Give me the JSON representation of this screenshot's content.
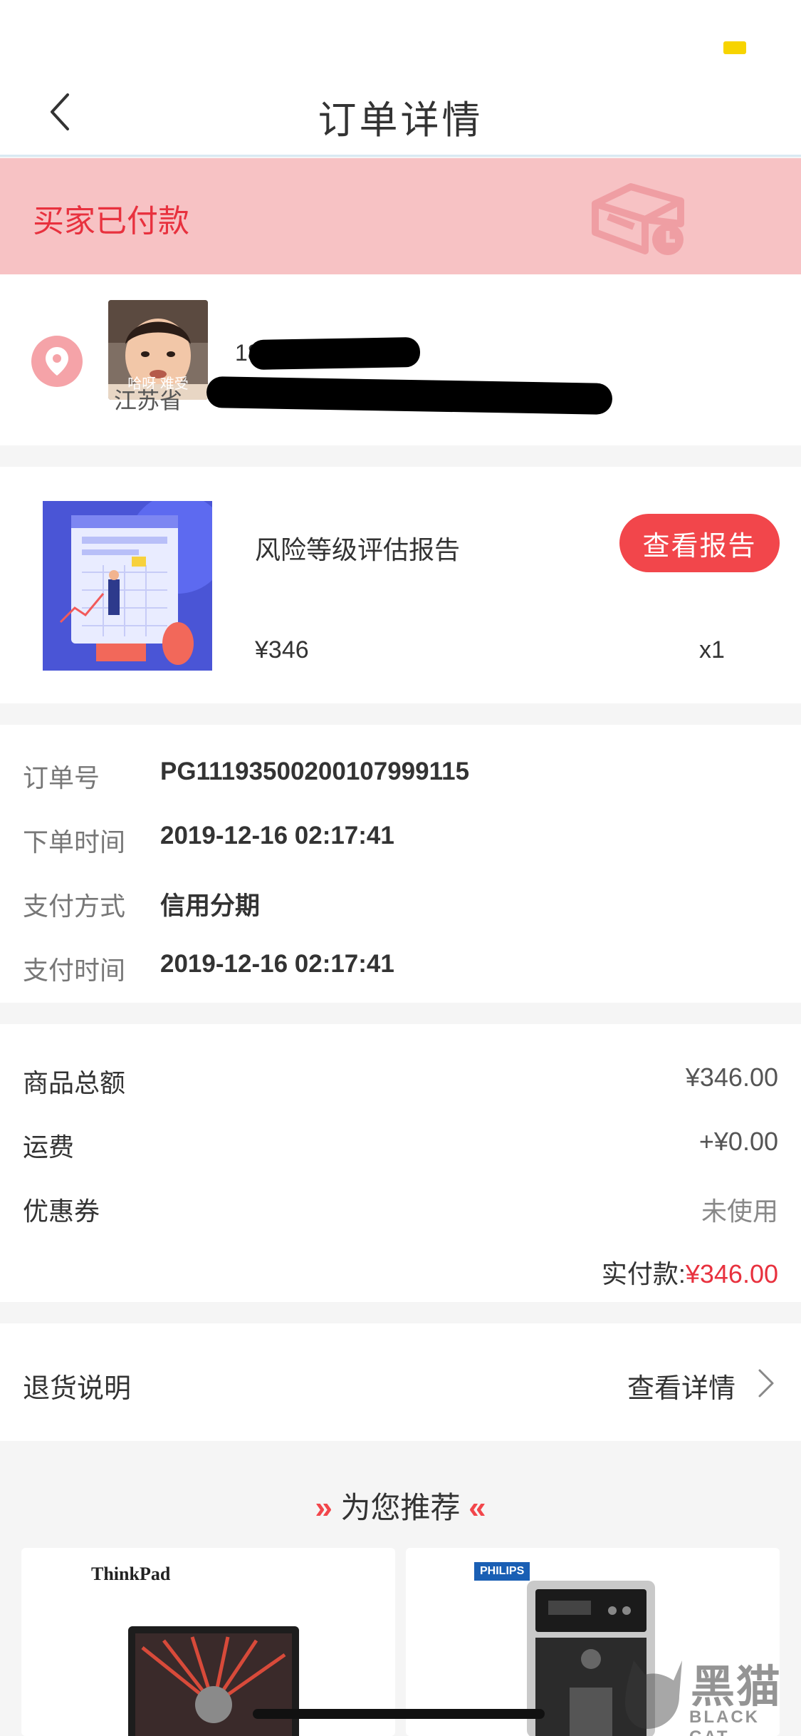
{
  "nav": {
    "title": "订单详情"
  },
  "status": {
    "text": "买家已付款"
  },
  "address": {
    "name": "18",
    "detail": "江苏省",
    "avatar_caption": "哈呀 难受"
  },
  "product": {
    "name": "风险等级评估报告",
    "button": "查看报告",
    "price": "¥346",
    "qty": "x1"
  },
  "order": {
    "rows": [
      {
        "label": "订单号",
        "value": "PG111935002001079991​15"
      },
      {
        "label": "下单时间",
        "value": "2019-12-16 02:17:41"
      },
      {
        "label": "支付方式",
        "value": "信用分期"
      },
      {
        "label": "支付时间",
        "value": "2019-12-16 02:17:41"
      }
    ]
  },
  "amount": {
    "goods_label": "商品总额",
    "goods_value": "¥346.00",
    "shipping_label": "运费",
    "shipping_value": "+¥0.00",
    "coupon_label": "优惠券",
    "coupon_value": "未使用",
    "paid_label": "实付款:",
    "paid_value": "¥346.00"
  },
  "returns": {
    "label": "退货说明",
    "link": "查看详情"
  },
  "recommend": {
    "title": "为您推荐",
    "left_arrows": "»",
    "right_arrows": "«",
    "items": [
      {
        "brand": "ThinkPad"
      },
      {
        "brand": "PHILIPS"
      }
    ]
  },
  "watermark": {
    "text": "黑猫",
    "sub": "BLACK CAT"
  },
  "colors": {
    "accent": "#f2464b",
    "banner": "#f7c2c4",
    "status_red": "#e8313e"
  },
  "icons": [
    "back-icon",
    "box-clock-icon",
    "location-icon",
    "chevron-right-icon"
  ]
}
